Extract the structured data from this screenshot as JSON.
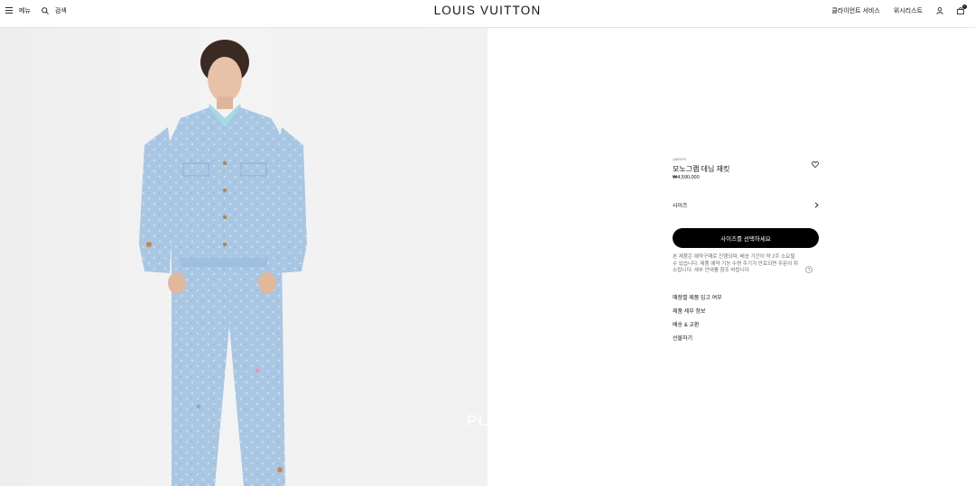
{
  "header": {
    "menu_label": "메뉴",
    "search_label": "검색",
    "brand": "LOUIS VUITTON",
    "client_service_label": "클라이언트 서비스",
    "wishlist_label": "위시리스트",
    "bag_count": "0"
  },
  "image": {
    "watermark": "PL"
  },
  "product": {
    "sku": "1AFKF9",
    "title": "모노그램 데님 재킷",
    "price": "₩4,590,000",
    "size_label": "사이즈",
    "select_button": "사이즈를 선택하세요",
    "notice": "본 제품은 예약구매로 진행되며, 배송 기간이 약 2주 소요될 수 있습니다. 제품 예약 기능 수량 주기가 만료되면 주문이 취소됩니다. 세부 안내를 참조 바랍니다.",
    "links": [
      "매장별 제품 입고 여부",
      "제품 세부 정보",
      "배송 & 교환",
      "선물하기"
    ]
  }
}
